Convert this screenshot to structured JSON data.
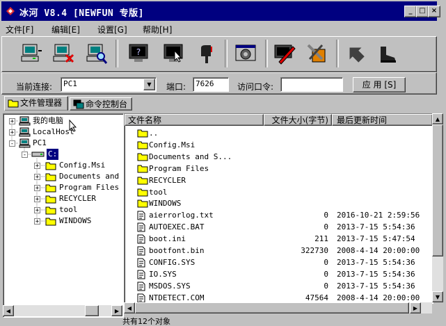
{
  "window": {
    "title": "冰河 V8.4 [NEWFUN 专版]",
    "controls": [
      "_",
      "□",
      "×"
    ]
  },
  "menu": [
    {
      "label": "文件[F]"
    },
    {
      "label": "编辑[E]"
    },
    {
      "label": "设置[G]"
    },
    {
      "label": "帮助[H]"
    }
  ],
  "toolbar": {
    "tools": [
      "connect-icon",
      "disconnect-icon",
      "search-host-icon",
      "screen-capture-icon",
      "screen-control-icon",
      "mail-icon",
      "config-server-icon",
      "pen-icon",
      "tools-icon",
      "back-icon",
      "boot-icon"
    ]
  },
  "connection": {
    "host_label": "当前连接:",
    "host_value": "PC1",
    "port_label": "端口:",
    "port_value": "7626",
    "password_label": "访问口令:",
    "password_value": "",
    "apply_label": "应 用 [S]"
  },
  "tabs": [
    {
      "label": "文件管理器",
      "active": true
    },
    {
      "label": "命令控制台",
      "active": false
    }
  ],
  "tree": {
    "nodes": [
      {
        "label": "我的电脑",
        "expander": "+"
      },
      {
        "label": "LocalHost",
        "expander": "+"
      },
      {
        "label": "PC1",
        "expander": "-"
      },
      {
        "label": "C:",
        "expander": "-"
      },
      {
        "label": "Config.Msi",
        "expander": "+"
      },
      {
        "label": "Documents and Settings",
        "expander": "+"
      },
      {
        "label": "Program Files",
        "expander": "+"
      },
      {
        "label": "RECYCLER",
        "expander": "+"
      },
      {
        "label": "tool",
        "expander": "+"
      },
      {
        "label": "WINDOWS",
        "expander": "+"
      }
    ]
  },
  "filelist": {
    "columns": [
      "文件名称",
      "文件大小(字节)",
      "最后更新时间"
    ],
    "rows": [
      {
        "name": "..",
        "size": "",
        "date": "",
        "type": "folder"
      },
      {
        "name": "Config.Msi",
        "size": "",
        "date": "",
        "type": "folder"
      },
      {
        "name": "Documents and S...",
        "size": "",
        "date": "",
        "type": "folder"
      },
      {
        "name": "Program Files",
        "size": "",
        "date": "",
        "type": "folder"
      },
      {
        "name": "RECYCLER",
        "size": "",
        "date": "",
        "type": "folder"
      },
      {
        "name": "tool",
        "size": "",
        "date": "",
        "type": "folder"
      },
      {
        "name": "WINDOWS",
        "size": "",
        "date": "",
        "type": "folder"
      },
      {
        "name": "aierrorlog.txt",
        "size": "0",
        "date": "2016-10-21 2:59:56",
        "type": "file"
      },
      {
        "name": "AUTOEXEC.BAT",
        "size": "0",
        "date": "2013-7-15 5:54:36",
        "type": "file"
      },
      {
        "name": "boot.ini",
        "size": "211",
        "date": "2013-7-15 5:47:54",
        "type": "file"
      },
      {
        "name": "bootfont.bin",
        "size": "322730",
        "date": "2008-4-14 20:00:00",
        "type": "file"
      },
      {
        "name": "CONFIG.SYS",
        "size": "0",
        "date": "2013-7-15 5:54:36",
        "type": "file"
      },
      {
        "name": "IO.SYS",
        "size": "0",
        "date": "2013-7-15 5:54:36",
        "type": "file"
      },
      {
        "name": "MSDOS.SYS",
        "size": "0",
        "date": "2013-7-15 5:54:36",
        "type": "file"
      },
      {
        "name": "NTDETECT.COM",
        "size": "47564",
        "date": "2008-4-14 20:00:00",
        "type": "file"
      }
    ]
  },
  "status": {
    "text": "共有12个对象"
  },
  "colors": {
    "titlebar": "#000080",
    "face": "#c0c0c0",
    "folder": "#ffff00",
    "selection": "#000080"
  }
}
